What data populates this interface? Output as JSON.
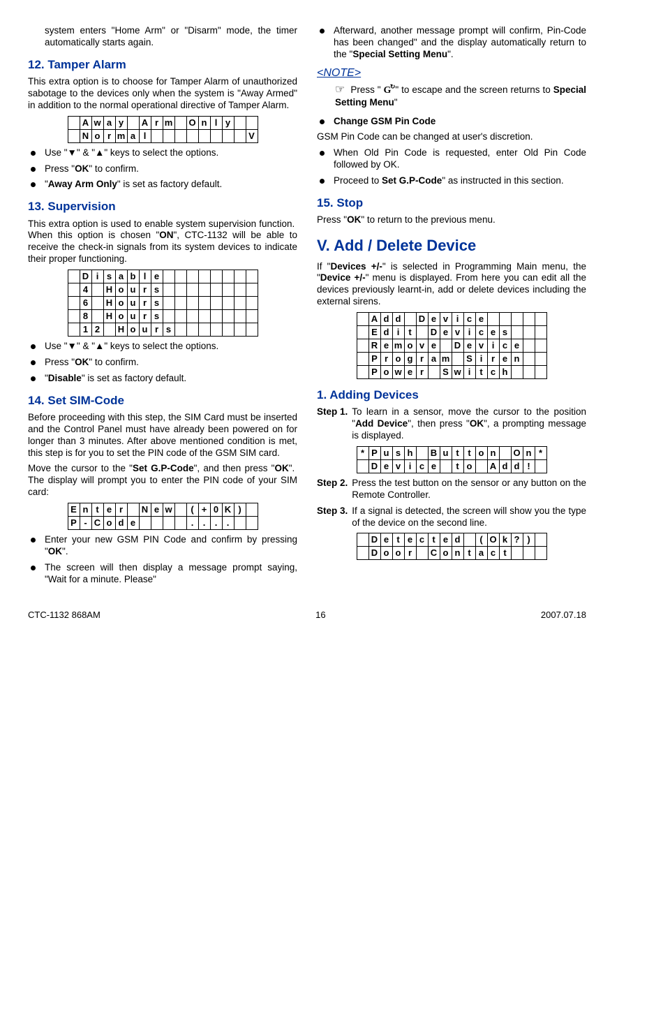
{
  "left": {
    "intro_cont": "system enters \"Home Arm\" or \"Disarm\" mode, the timer automatically starts again.",
    "s12": {
      "title": "12. Tamper Alarm",
      "p1": "This extra option is to choose for Tamper Alarm of unauthorized sabotage to the devices only when the system is \"Away Armed\" in addition to the normal operational directive of Tamper Alarm.",
      "b1": "Use \"▼\" & \"▲\" keys to select the options.",
      "b2": "Press \"OK\" to confirm.",
      "b3": "\"Away Arm Only\" is set as factory default."
    },
    "s13": {
      "title": "13. Supervision",
      "p1": "This extra option is used to enable system supervision function.  When this option is chosen \"ON\", CTC-1132 will be able to receive the check-in signals from its system devices to indicate their proper functioning.",
      "b1": "Use \"▼\" & \"▲\" keys to select the options.",
      "b2": "Press \"OK\" to confirm.",
      "b3": "\"Disable\" is set as factory default."
    },
    "s14": {
      "title": "14. Set SIM-Code",
      "p1": "Before proceeding with this step, the SIM Card must be inserted and the Control Panel must have already been powered on for longer than 3 minutes.  After above mentioned condition is met, this step is for you to set the PIN code of the GSM SIM card.",
      "p2": "Move the cursor to the \"Set G.P-Code\", and then press \"OK\".  The display will prompt you to enter the PIN code of your SIM card:",
      "b1": "Enter your new GSM PIN Code and confirm by pressing \"OK\".",
      "b2": "The screen will then display a message prompt saying, \"Wait for a minute. Please\""
    },
    "lcd_away": [
      [
        " ",
        "A",
        "w",
        "a",
        "y",
        " ",
        "A",
        "r",
        "m",
        " ",
        "O",
        "n",
        "l",
        "y",
        " ",
        " "
      ],
      [
        " ",
        "N",
        "o",
        "r",
        "m",
        "a",
        "l",
        " ",
        " ",
        " ",
        " ",
        " ",
        " ",
        " ",
        " ",
        "V"
      ]
    ],
    "lcd_supervision": [
      [
        " ",
        "D",
        "i",
        "s",
        "a",
        "b",
        "l",
        "e",
        " ",
        " ",
        " ",
        " ",
        " ",
        " ",
        " ",
        " "
      ],
      [
        " ",
        "4",
        " ",
        "H",
        "o",
        "u",
        "r",
        "s",
        " ",
        " ",
        " ",
        " ",
        " ",
        " ",
        " ",
        " "
      ],
      [
        " ",
        "6",
        " ",
        "H",
        "o",
        "u",
        "r",
        "s",
        " ",
        " ",
        " ",
        " ",
        " ",
        " ",
        " ",
        " "
      ],
      [
        " ",
        "8",
        " ",
        "H",
        "o",
        "u",
        "r",
        "s",
        " ",
        " ",
        " ",
        " ",
        " ",
        " ",
        " ",
        " "
      ],
      [
        " ",
        "1",
        "2",
        " ",
        "H",
        "o",
        "u",
        "r",
        "s",
        " ",
        " ",
        " ",
        " ",
        " ",
        " ",
        " "
      ]
    ],
    "lcd_pcode": [
      [
        "E",
        "n",
        "t",
        "e",
        "r",
        " ",
        "N",
        "e",
        "w",
        " ",
        "(",
        "+",
        "0",
        "K",
        ")",
        " "
      ],
      [
        "P",
        "-",
        "C",
        "o",
        "d",
        "e",
        " ",
        " ",
        " ",
        " ",
        ".",
        ".",
        ".",
        ".",
        " ",
        " "
      ]
    ]
  },
  "right": {
    "cont_b1": "Afterward, another message prompt will confirm, Pin-Code has been changed\" and the display automatically return to the \"Special Setting Menu\".",
    "note_title": "<NOTE>",
    "note_line_a": "Press \" ",
    "note_line_b": " \" to escape and the screen returns to Special Setting Menu\"",
    "gsm": {
      "b_title": "Change GSM Pin Code",
      "p1": "GSM Pin Code can be changed at user's discretion.",
      "b1": "When Old Pin Code is requested, enter Old Pin Code followed by OK.",
      "b2": "Proceed to Set G.P-Code\" as instructed in this section."
    },
    "s15": {
      "title": "15. Stop",
      "p1": "Press \"OK\" to return to the previous menu."
    },
    "sV": {
      "title": "V. Add / Delete Device",
      "p1": "If \"Devices +/-\" is selected in Programming Main menu, the \"Device +/-\" menu is displayed. From here you can edit all the devices previously learnt-in, add or delete devices including the external sirens."
    },
    "lcd_devices": [
      [
        " ",
        "A",
        "d",
        "d",
        " ",
        "D",
        "e",
        "v",
        "i",
        "c",
        "e",
        " ",
        " ",
        " ",
        " ",
        " "
      ],
      [
        " ",
        "E",
        "d",
        "i",
        "t",
        " ",
        "D",
        "e",
        "v",
        "i",
        "c",
        "e",
        "s",
        " ",
        " ",
        " "
      ],
      [
        " ",
        "R",
        "e",
        "m",
        "o",
        "v",
        "e",
        " ",
        "D",
        "e",
        "v",
        "i",
        "c",
        "e",
        " ",
        " "
      ],
      [
        " ",
        "P",
        "r",
        "o",
        "g",
        "r",
        "a",
        "m",
        " ",
        "S",
        "i",
        "r",
        "e",
        "n",
        " ",
        " "
      ],
      [
        " ",
        "P",
        "o",
        "w",
        "e",
        "r",
        " ",
        "S",
        "w",
        "i",
        "t",
        "c",
        "h",
        " ",
        " ",
        " "
      ]
    ],
    "s1add": {
      "title": "1. Adding Devices",
      "step1_label": "Step 1.",
      "step1_body": "To learn in a sensor, move the cursor to the position \"Add Device\", then press \"OK\", a prompting message is displayed.",
      "step2_label": "Step 2.",
      "step2_body": "Press the test button on the sensor or any button on the Remote Controller.",
      "step3_label": "Step 3.",
      "step3_body": "If a signal is detected, the screen will show you the type of the device on the second line."
    },
    "lcd_push": [
      [
        "*",
        "P",
        "u",
        "s",
        "h",
        " ",
        "B",
        "u",
        "t",
        "t",
        "o",
        "n",
        " ",
        "O",
        "n",
        "*"
      ],
      [
        " ",
        "D",
        "e",
        "v",
        "i",
        "c",
        "e",
        " ",
        "t",
        "o",
        " ",
        "A",
        "d",
        "d",
        "!",
        " "
      ]
    ],
    "lcd_detected": [
      [
        " ",
        "D",
        "e",
        "t",
        "e",
        "c",
        "t",
        "e",
        "d",
        " ",
        "(",
        "O",
        "k",
        "?",
        ")",
        " "
      ],
      [
        " ",
        "D",
        "o",
        "o",
        "r",
        " ",
        "C",
        "o",
        "n",
        "t",
        "a",
        "c",
        "t",
        " ",
        " ",
        " "
      ]
    ]
  },
  "footer": {
    "left": "CTC-1132 868AM",
    "center": "16",
    "right": "2007.07.18"
  }
}
